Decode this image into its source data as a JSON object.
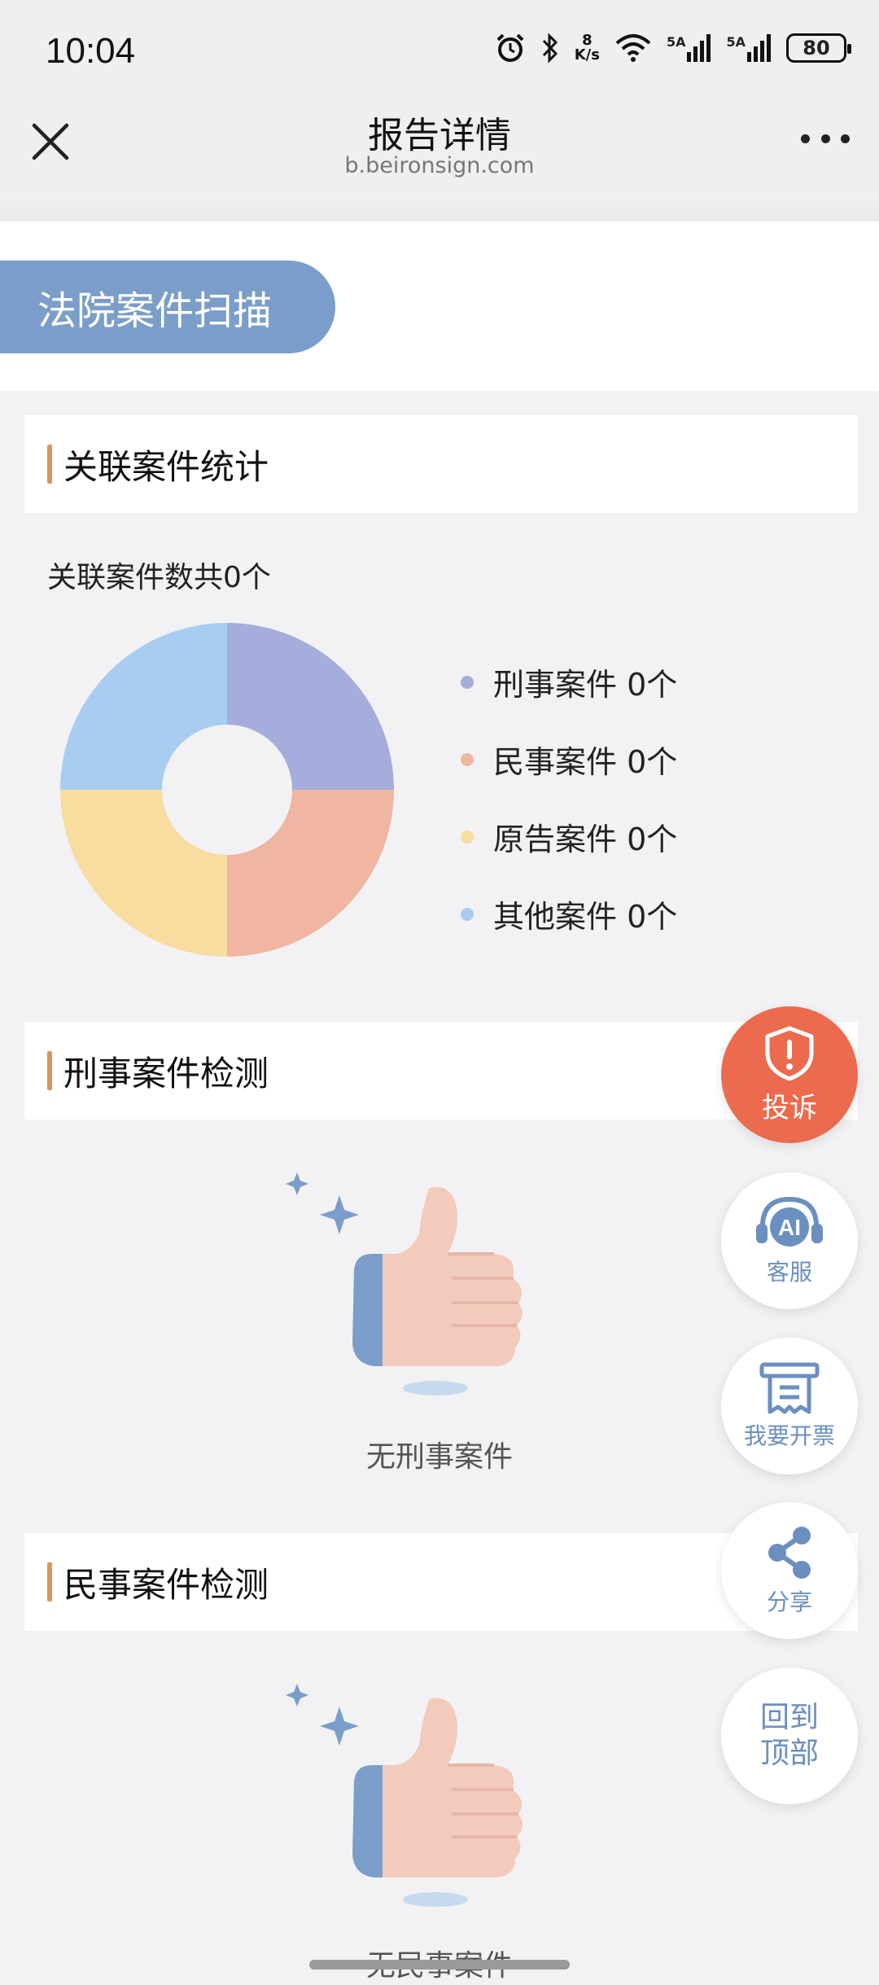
{
  "status_bar": {
    "time": "10:04",
    "speed_top": "8",
    "speed_unit": "K/s",
    "signal1": "5A",
    "signal2": "5A",
    "battery": "80"
  },
  "nav": {
    "title": "报告详情",
    "url": "b.beironsign.com",
    "close_icon": "close-icon",
    "more_icon": "more-icon"
  },
  "section_title": "法院案件扫描",
  "stats": {
    "header": "关联案件统计",
    "total": "关联案件数共0个",
    "legend": [
      {
        "label": "刑事案件 0个",
        "color": "#a4addb"
      },
      {
        "label": "民事案件 0个",
        "color": "#f0b6a1"
      },
      {
        "label": "原告案件 0个",
        "color": "#f8dca0"
      },
      {
        "label": "其他案件 0个",
        "color": "#a9cdf0"
      }
    ]
  },
  "criminal": {
    "header": "刑事案件检测",
    "empty_text": "无刑事案件"
  },
  "civil": {
    "header": "民事案件检测",
    "empty_text": "无民事案件"
  },
  "fabs": {
    "complaint": "投诉",
    "ai": "AI",
    "service": "客服",
    "invoice": "我要开票",
    "share": "分享",
    "top_line1": "回到",
    "top_line2": "顶部"
  },
  "colors": {
    "accent": "#7a9ec9",
    "header_bar": "#d5975c",
    "complaint_red": "#ec6a4e"
  }
}
